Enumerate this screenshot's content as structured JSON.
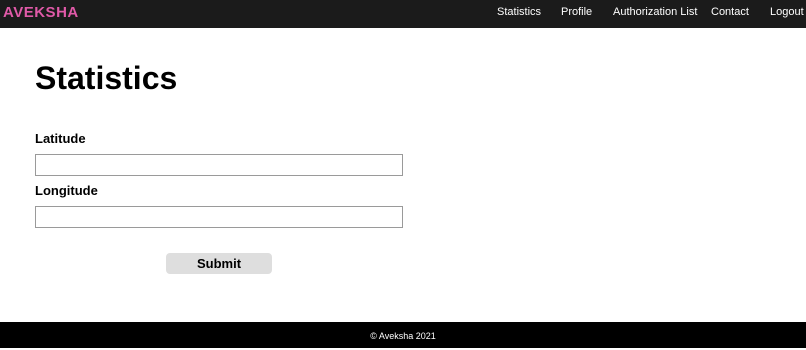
{
  "navbar": {
    "brand": "AVEKSHA",
    "links": [
      "Statistics",
      "Profile",
      "Authorization List",
      "Contact",
      "Logout"
    ]
  },
  "page": {
    "title": "Statistics"
  },
  "form": {
    "latitude_label": "Latitude",
    "latitude_value": "",
    "longitude_label": "Longitude",
    "longitude_value": "",
    "submit_label": "Submit"
  },
  "footer": {
    "text": "© Aveksha 2021"
  },
  "colors": {
    "navbar_bg": "#1b1b1b",
    "brand": "#e05aa8",
    "footer_bg": "#000000",
    "button_bg": "#dedede"
  }
}
